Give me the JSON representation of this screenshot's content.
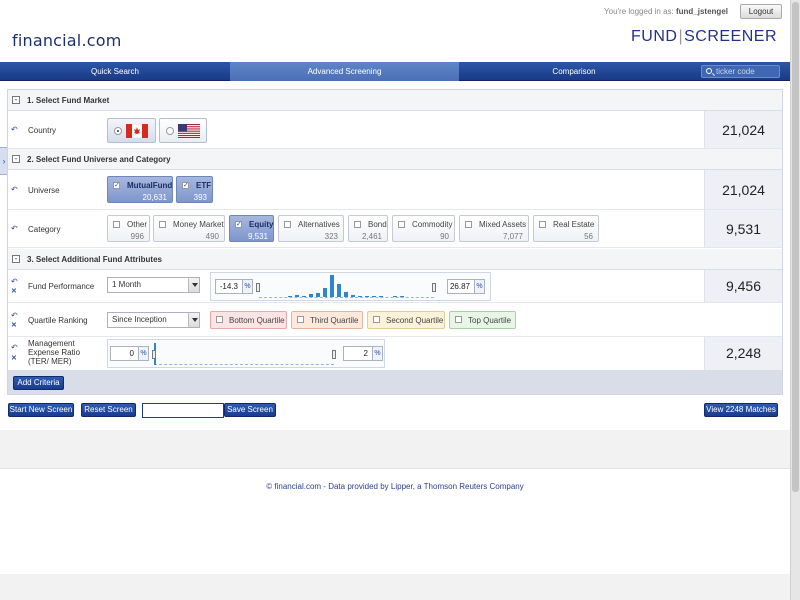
{
  "header": {
    "login_prefix": "You're logged in as:",
    "username": "fund_jstengel",
    "logout_label": "Logout",
    "logo": "financial.com",
    "brand_left": "FUND",
    "brand_sep": "|",
    "brand_right": "SCREENER"
  },
  "nav": {
    "tabs": [
      {
        "label": "Quick Search",
        "active": false
      },
      {
        "label": "Advanced Screening",
        "active": true
      },
      {
        "label": "Comparison",
        "active": false
      }
    ],
    "ticker_placeholder": "ticker code"
  },
  "section1": {
    "title": "1. Select Fund Market",
    "country_label": "Country",
    "country_count": "21,024",
    "flags": [
      {
        "name": "canada-flag",
        "selected": true
      },
      {
        "name": "usa-flag",
        "selected": false
      }
    ]
  },
  "section2": {
    "title": "2. Select Fund Universe and Category",
    "universe_label": "Universe",
    "universe_count": "21,024",
    "universe": [
      {
        "name": "MutualFund",
        "count": "20,631",
        "checked": true
      },
      {
        "name": "ETF",
        "count": "393",
        "checked": true
      }
    ],
    "category_label": "Category",
    "category_count": "9,531",
    "categories": [
      {
        "name": "Other",
        "count": "996",
        "checked": false
      },
      {
        "name": "Money Market",
        "count": "490",
        "checked": false
      },
      {
        "name": "Equity",
        "count": "9,531",
        "checked": true
      },
      {
        "name": "Alternatives",
        "count": "323",
        "checked": false
      },
      {
        "name": "Bond",
        "count": "2,461",
        "checked": false
      },
      {
        "name": "Commodity",
        "count": "90",
        "checked": false
      },
      {
        "name": "Mixed Assets",
        "count": "7,077",
        "checked": false
      },
      {
        "name": "Real Estate",
        "count": "56",
        "checked": false
      }
    ]
  },
  "section3": {
    "title": "3. Select Additional Fund Attributes",
    "performance_label": "Fund Performance",
    "performance_period": "1 Month",
    "performance_min": "-14.3",
    "performance_max": "26.87",
    "performance_count": "9,456",
    "histogram": [
      0,
      0,
      0,
      0,
      1,
      2,
      1,
      3,
      4,
      10,
      24,
      14,
      5,
      2,
      1,
      1,
      1,
      1,
      0,
      1,
      1,
      0,
      0,
      0,
      0
    ],
    "quartile_label": "Quartile Ranking",
    "quartile_period": "Since Inception",
    "quartiles": [
      {
        "name": "Bottom Quartile",
        "bg": "#fbe4e4",
        "border": "#e5a9a9"
      },
      {
        "name": "Third Quartile",
        "bg": "#fde9dc",
        "border": "#e6b59a"
      },
      {
        "name": "Second Quartile",
        "bg": "#fbf2d9",
        "border": "#e0cf98"
      },
      {
        "name": "Top Quartile",
        "bg": "#e8f6e6",
        "border": "#a6d3a2"
      }
    ],
    "ter_label_1": "Management",
    "ter_label_2": "Expense Ratio",
    "ter_label_3": "(TER/ MER)",
    "ter_min": "0",
    "ter_max": "2",
    "ter_count": "2,248",
    "pct_symbol": "%"
  },
  "actions": {
    "add_criteria": "Add Criteria",
    "start_new": "Start New Screen",
    "reset": "Reset Screen",
    "save": "Save Screen",
    "view_matches": "View 2248 Matches"
  },
  "footer": {
    "text": "© financial.com - Data provided by Lipper, a Thomson Reuters Company"
  },
  "colors": {
    "nav": "#1a3a86",
    "accent": "#2f86d0"
  }
}
